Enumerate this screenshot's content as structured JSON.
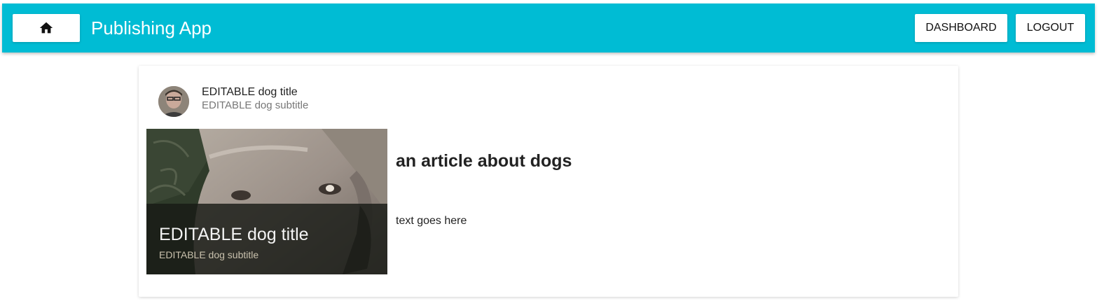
{
  "appbar": {
    "title": "Publishing App",
    "home_icon": "home-icon",
    "background_color": "#00bcd4",
    "dashboard_label": "DASHBOARD",
    "logout_label": "LOGOUT"
  },
  "card": {
    "header": {
      "title": "EDITABLE dog title",
      "subtitle": "EDITABLE dog subtitle",
      "avatar_icon": "user-avatar-photo"
    },
    "media": {
      "image": "dog-photo",
      "overlay_title": "EDITABLE dog title",
      "overlay_subtitle": "EDITABLE dog subtitle"
    },
    "article": {
      "heading": "an article about dogs",
      "body": "text goes here"
    }
  }
}
